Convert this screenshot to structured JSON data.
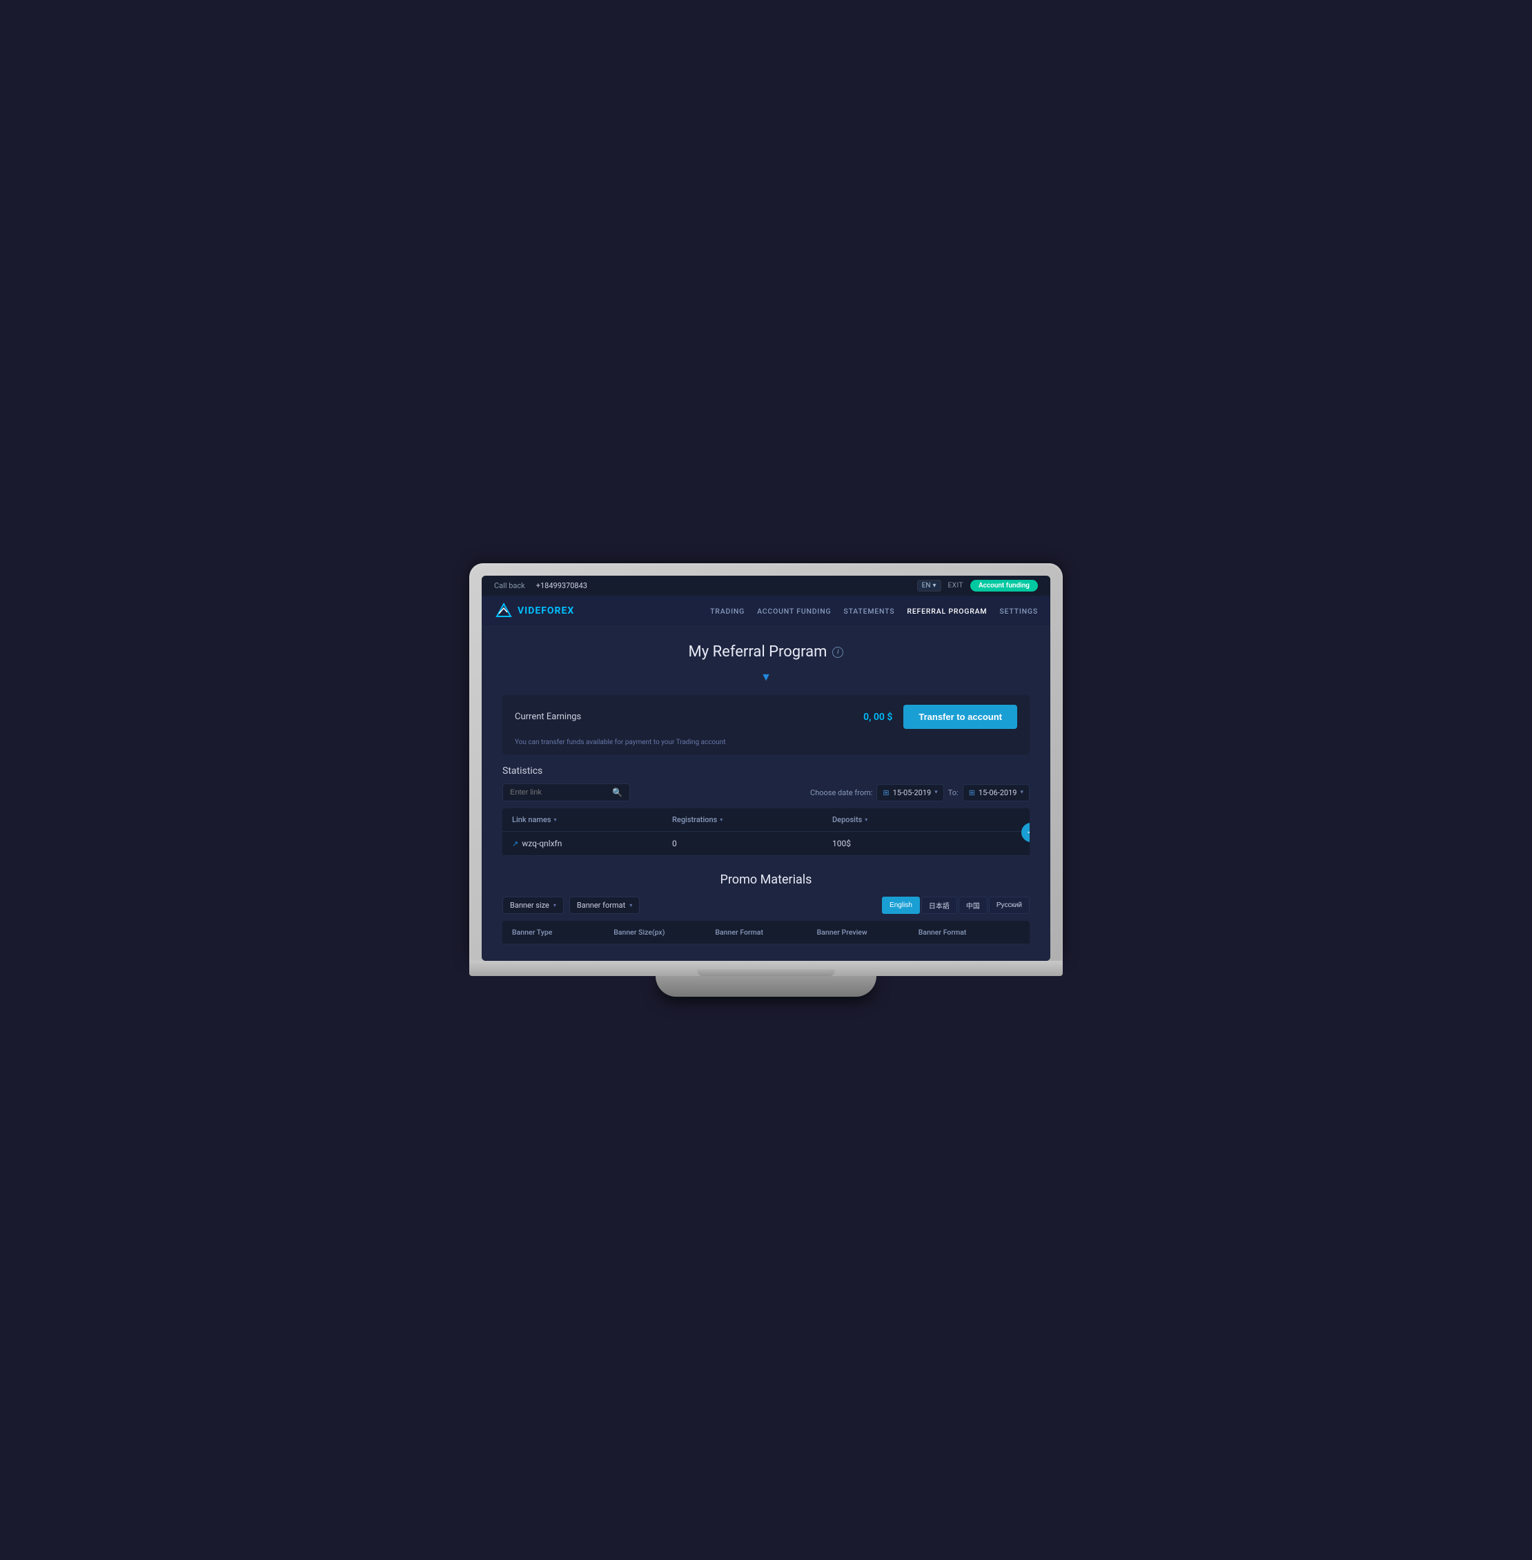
{
  "topbar": {
    "callback_label": "Call back",
    "phone": "+18499370843",
    "lang": "EN",
    "lang_arrow": "▾",
    "exit": "EXIT",
    "account_funding_btn": "Account funding"
  },
  "nav": {
    "logo_vide": "VIDE",
    "logo_forex": "FOREX",
    "links": [
      {
        "label": "TRADING",
        "active": false
      },
      {
        "label": "ACCOUNT FUNDING",
        "active": false
      },
      {
        "label": "STATEMENTS",
        "active": false
      },
      {
        "label": "REFERRAL PROGRAM",
        "active": true
      },
      {
        "label": "SETTINGS",
        "active": false
      }
    ]
  },
  "page": {
    "title": "My Referral Program",
    "info_icon": "i",
    "chevron": "▼"
  },
  "earnings": {
    "label": "Current Earnings",
    "value": "0, 00 $",
    "transfer_btn": "Transfer to account",
    "note": "You can transfer funds available for payment to your Trading account"
  },
  "statistics": {
    "title": "Statistics",
    "search_placeholder": "Enter link",
    "date_from_label": "Choose date from:",
    "date_from": "15-05-2019",
    "date_to_label": "To:",
    "date_to": "15-06-2019",
    "columns": [
      {
        "label": "Link names"
      },
      {
        "label": "Registrations"
      },
      {
        "label": "Deposits"
      }
    ],
    "rows": [
      {
        "link": "wzq-qnlxfn",
        "registrations": "0",
        "deposits": "100$"
      }
    ],
    "add_btn": "+"
  },
  "promo": {
    "title": "Promo Materials",
    "dropdown1": "Banner size",
    "dropdown2": "Banner format",
    "languages": [
      {
        "label": "English",
        "active": true
      },
      {
        "label": "日本語",
        "active": false
      },
      {
        "label": "中国",
        "active": false
      },
      {
        "label": "Русский",
        "active": false
      }
    ],
    "banner_columns": [
      "Banner Type",
      "Banner Size(px)",
      "Banner Format",
      "Banner Preview",
      "Banner Format"
    ]
  },
  "colors": {
    "accent": "#1a9fd4",
    "green": "#00c8a0",
    "dark_bg": "#1a2035",
    "medium_bg": "#1e2540",
    "light_bg": "#151c2e"
  }
}
